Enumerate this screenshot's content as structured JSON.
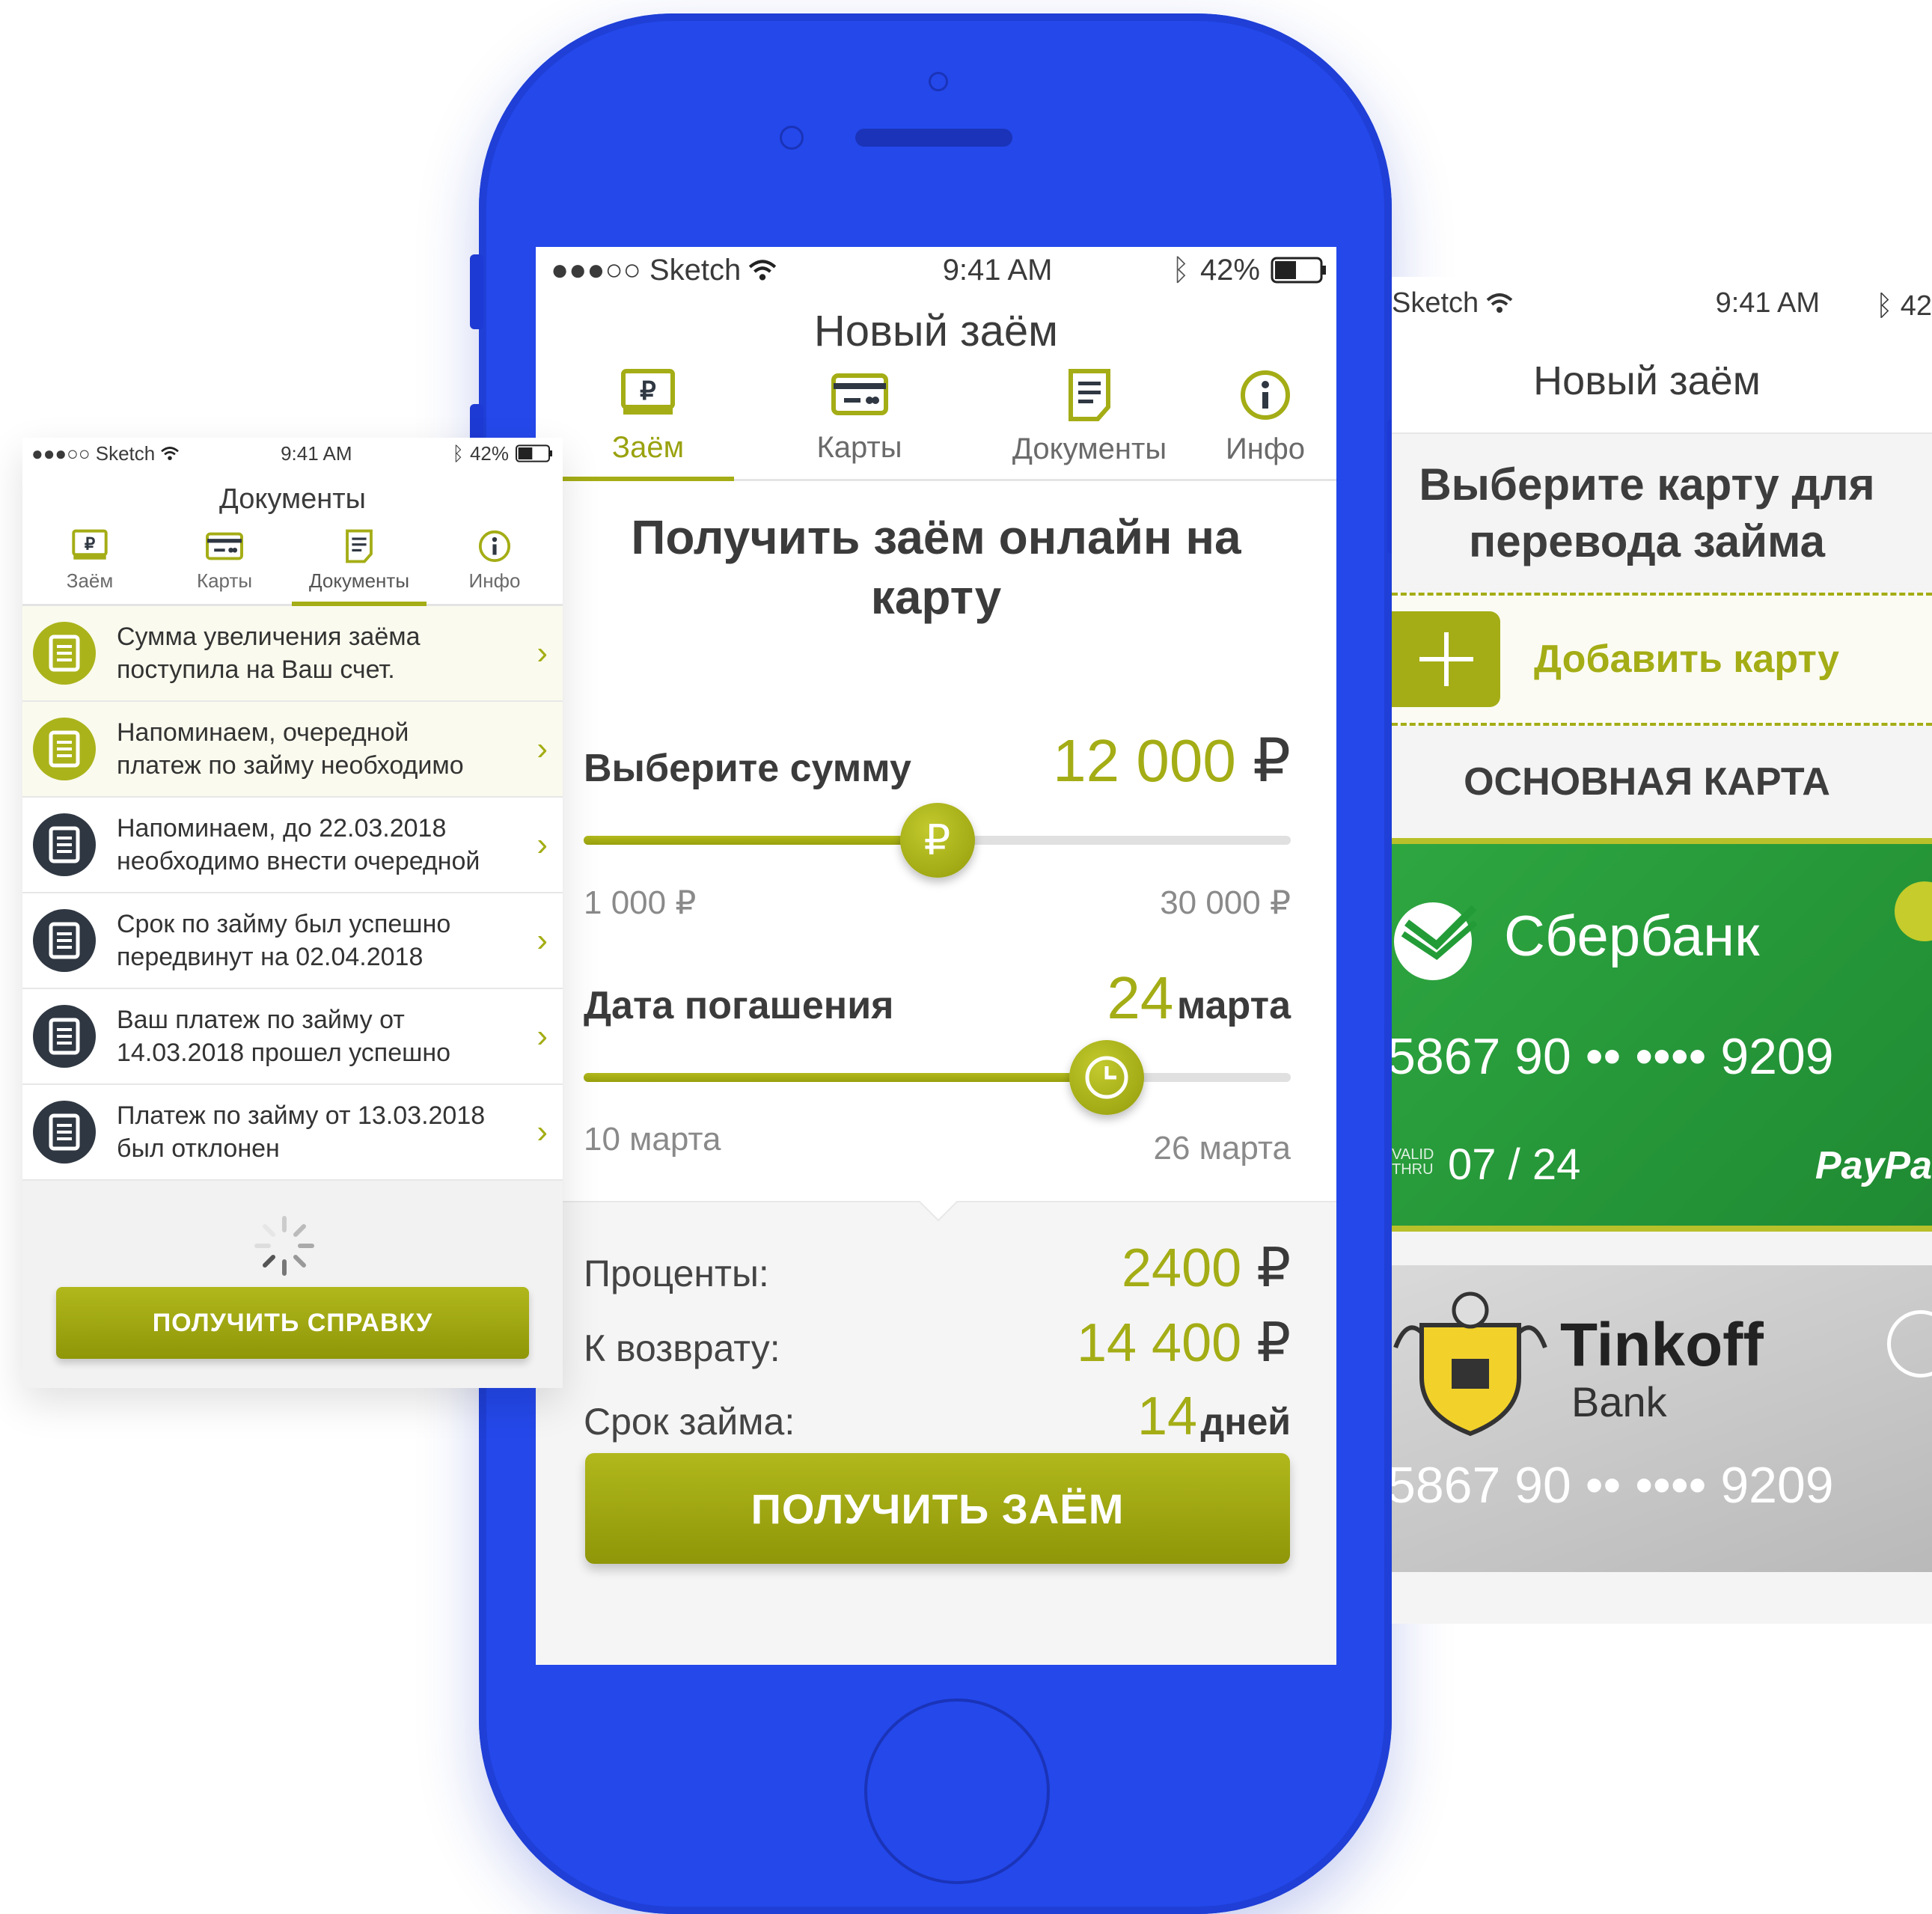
{
  "colors": {
    "phone": "#2448ea",
    "accent": "#a4ad15",
    "dark_icon": "#2f3742",
    "sber_green": "#2ea640"
  },
  "main": {
    "status": {
      "carrier": "●●●○○ Sketch",
      "time": "9:41 AM",
      "battery": "42%"
    },
    "title": "Новый заём",
    "tabs": [
      {
        "label": "Заём",
        "icon": "ruble-doc-icon",
        "active": true
      },
      {
        "label": "Карты",
        "icon": "card-icon",
        "active": false
      },
      {
        "label": "Документы",
        "icon": "document-icon",
        "active": false
      },
      {
        "label": "Инфо",
        "icon": "info-icon",
        "active": false
      }
    ],
    "heading": "Получить заём онлайн на карту",
    "amount": {
      "label": "Выберите сумму",
      "value": "12 000",
      "currency": "₽",
      "min": "1 000 ₽",
      "max": "30 000 ₽",
      "knob": "₽",
      "fraction": 0.5
    },
    "date": {
      "label": "Дата погашения",
      "value": "24",
      "unit": "марта",
      "min": "10 марта",
      "max": "26 марта",
      "fraction": 0.74
    },
    "summary": [
      {
        "label": "Проценты:",
        "value": "2400",
        "unit": "₽"
      },
      {
        "label": "К возврату:",
        "value": "14 400",
        "unit": "₽"
      },
      {
        "label": "Срок займа:",
        "value": "14",
        "unit": "дней"
      }
    ],
    "button": "ПОЛУЧИТЬ ЗАЁМ"
  },
  "left": {
    "status": {
      "carrier": "●●●○○ Sketch",
      "time": "9:41 AM",
      "battery": "42%"
    },
    "title": "Документы",
    "tabs": [
      {
        "label": "Заём",
        "active": false
      },
      {
        "label": "Карты",
        "active": false
      },
      {
        "label": "Документы",
        "active": true
      },
      {
        "label": "Инфо",
        "active": false
      }
    ],
    "docs": [
      {
        "line1": "Сумма увеличения заёма",
        "line2": "поступила на Ваш счет.",
        "style": "y"
      },
      {
        "line1": "Напоминаем, очередной",
        "line2": "платеж по займу необходимо",
        "style": "y"
      },
      {
        "line1": "Напоминаем, до 22.03.2018",
        "line2": "необходимо внести очередной",
        "style": "d"
      },
      {
        "line1": "Срок по займу был успешно",
        "line2": "передвинут на 02.04.2018",
        "style": "d"
      },
      {
        "line1": "Ваш платеж по займу от",
        "line2": "14.03.2018 прошел  успешно",
        "style": "d"
      },
      {
        "line1": "Платеж по займу от 13.03.2018",
        "line2": "был отклонен",
        "style": "d"
      }
    ],
    "button": "ПОЛУЧИТЬ СПРАВКУ"
  },
  "right": {
    "status": {
      "carrier": "Sketch",
      "time": "9:41 AM",
      "battery": "42"
    },
    "title": "Новый заём",
    "heading_line1": "Выберите карту для",
    "heading_line2": "перевода займа",
    "add_card": "Добавить карту",
    "section": "ОСНОВНАЯ КАРТА",
    "cards": [
      {
        "bank": "Сбербанк",
        "number": "5867 90 ••  •••• 9209",
        "valid_label1": "VALID",
        "valid_label2": "THRU",
        "valid": "07 / 24",
        "brand": "PayPa"
      },
      {
        "bank": "Tinkoff",
        "bank_sub": "Bank",
        "number": "5867 90 ••  •••• 9209"
      }
    ]
  }
}
